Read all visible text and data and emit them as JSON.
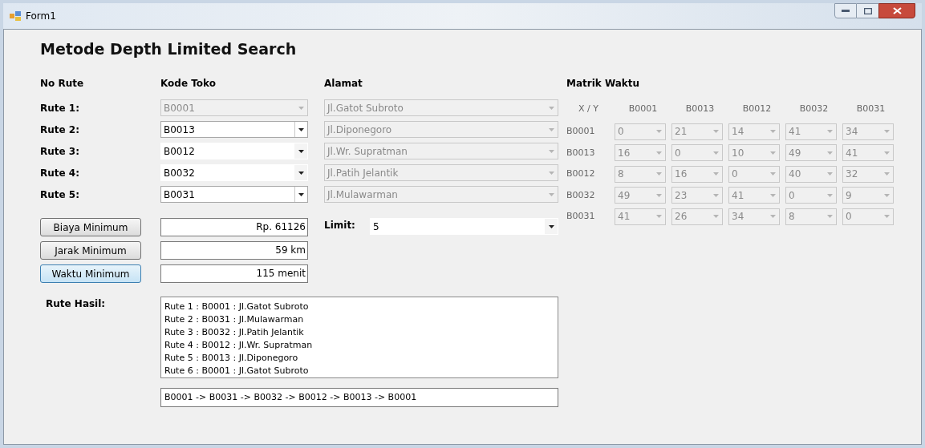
{
  "window": {
    "title": "Form1"
  },
  "heading": "Metode Depth Limited Search",
  "columns": {
    "no_rute": "No Rute",
    "kode_toko": "Kode Toko",
    "alamat": "Alamat"
  },
  "routes": [
    {
      "label": "Rute 1:",
      "kode": {
        "value": "B0001",
        "disabled": true,
        "bordered": true
      },
      "alamat": {
        "value": "Jl.Gatot Subroto",
        "disabled": true
      }
    },
    {
      "label": "Rute 2:",
      "kode": {
        "value": "B0013",
        "disabled": false,
        "bordered": true
      },
      "alamat": {
        "value": "Jl.Diponegoro",
        "disabled": true
      }
    },
    {
      "label": "Rute 3:",
      "kode": {
        "value": "B0012",
        "disabled": false,
        "bordered": false
      },
      "alamat": {
        "value": "Jl.Wr. Supratman",
        "disabled": true
      }
    },
    {
      "label": "Rute 4:",
      "kode": {
        "value": "B0032",
        "disabled": false,
        "bordered": false
      },
      "alamat": {
        "value": "Jl.Patih Jelantik",
        "disabled": true
      }
    },
    {
      "label": "Rute 5:",
      "kode": {
        "value": "B0031",
        "disabled": false,
        "bordered": true
      },
      "alamat": {
        "value": "Jl.Mulawarman",
        "disabled": true
      }
    }
  ],
  "results": [
    {
      "button": "Biaya Minimum",
      "focused": false,
      "value": "Rp. 61126"
    },
    {
      "button": "Jarak Minimum",
      "focused": false,
      "value": "59 km"
    },
    {
      "button": "Waktu Minimum",
      "focused": true,
      "value": "115 menit"
    }
  ],
  "limit": {
    "label": "Limit:",
    "value": "5"
  },
  "rute_hasil": {
    "label": "Rute Hasil:",
    "lines": [
      "Rute 1 : B0001 : Jl.Gatot Subroto",
      "Rute 2 : B0031 : Jl.Mulawarman",
      "Rute 3 : B0032 : Jl.Patih Jelantik",
      "Rute 4 : B0012 : Jl.Wr. Supratman",
      "Rute 5 : B0013 : Jl.Diponegoro",
      "Rute 6 : B0001 : Jl.Gatot Subroto"
    ],
    "path": "B0001 -> B0031 -> B0032 -> B0012 -> B0013 -> B0001"
  },
  "matrix": {
    "title": "Matrik Waktu",
    "corner": "X / Y",
    "disabled": true,
    "columns": [
      "B0001",
      "B0013",
      "B0012",
      "B0032",
      "B0031"
    ],
    "rows": [
      {
        "label": "B0001",
        "cells": [
          "0",
          "21",
          "14",
          "41",
          "34"
        ]
      },
      {
        "label": "B0013",
        "cells": [
          "16",
          "0",
          "10",
          "49",
          "41"
        ]
      },
      {
        "label": "B0012",
        "cells": [
          "8",
          "16",
          "0",
          "40",
          "32"
        ]
      },
      {
        "label": "B0032",
        "cells": [
          "49",
          "23",
          "41",
          "0",
          "9"
        ]
      },
      {
        "label": "B0031",
        "cells": [
          "41",
          "26",
          "34",
          "8",
          "0"
        ]
      }
    ]
  }
}
